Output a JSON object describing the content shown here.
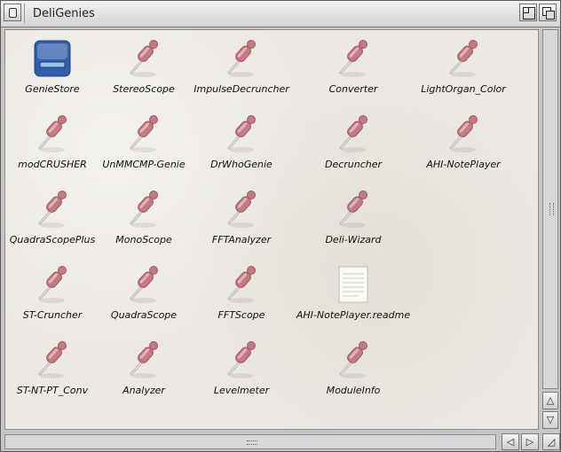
{
  "window": {
    "title": "DeliGenies"
  },
  "colors": {
    "content_bg": "#ece9e4",
    "title_bg": "#e4e4e4",
    "screwdriver": "#c47a82",
    "drive": "#2f5fa8"
  },
  "scroll": {
    "up": "△",
    "down": "▽",
    "left": "◁",
    "right": "▷",
    "size": "◿"
  },
  "icons": [
    {
      "label": "GenieStore",
      "icon": "drive-icon"
    },
    {
      "label": "StereoScope",
      "icon": "screwdriver-icon"
    },
    {
      "label": "ImpulseDecruncher",
      "icon": "screwdriver-icon"
    },
    {
      "label": "Converter",
      "icon": "screwdriver-icon"
    },
    {
      "label": "LightOrgan_Color",
      "icon": "screwdriver-icon"
    },
    {
      "label": "modCRUSHER",
      "icon": "screwdriver-icon"
    },
    {
      "label": "UnMMCMP-Genie",
      "icon": "screwdriver-icon"
    },
    {
      "label": "DrWhoGenie",
      "icon": "screwdriver-icon"
    },
    {
      "label": "Decruncher",
      "icon": "screwdriver-icon"
    },
    {
      "label": "AHI-NotePlayer",
      "icon": "screwdriver-icon"
    },
    {
      "label": "QuadraScopePlus",
      "icon": "screwdriver-icon"
    },
    {
      "label": "MonoScope",
      "icon": "screwdriver-icon"
    },
    {
      "label": "FFTAnalyzer",
      "icon": "screwdriver-icon"
    },
    {
      "label": "Deli-Wizard",
      "icon": "screwdriver-icon"
    },
    {
      "label": "ST-Cruncher",
      "icon": "screwdriver-icon"
    },
    {
      "label": "QuadraScope",
      "icon": "screwdriver-icon"
    },
    {
      "label": "FFTScope",
      "icon": "screwdriver-icon"
    },
    {
      "label": "AHI-NotePlayer.readme",
      "icon": "document-icon"
    },
    {
      "label": "ST-NT-PT_Conv",
      "icon": "screwdriver-icon"
    },
    {
      "label": "Analyzer",
      "icon": "screwdriver-icon"
    },
    {
      "label": "Levelmeter",
      "icon": "screwdriver-icon"
    },
    {
      "label": "ModuleInfo",
      "icon": "screwdriver-icon"
    }
  ]
}
